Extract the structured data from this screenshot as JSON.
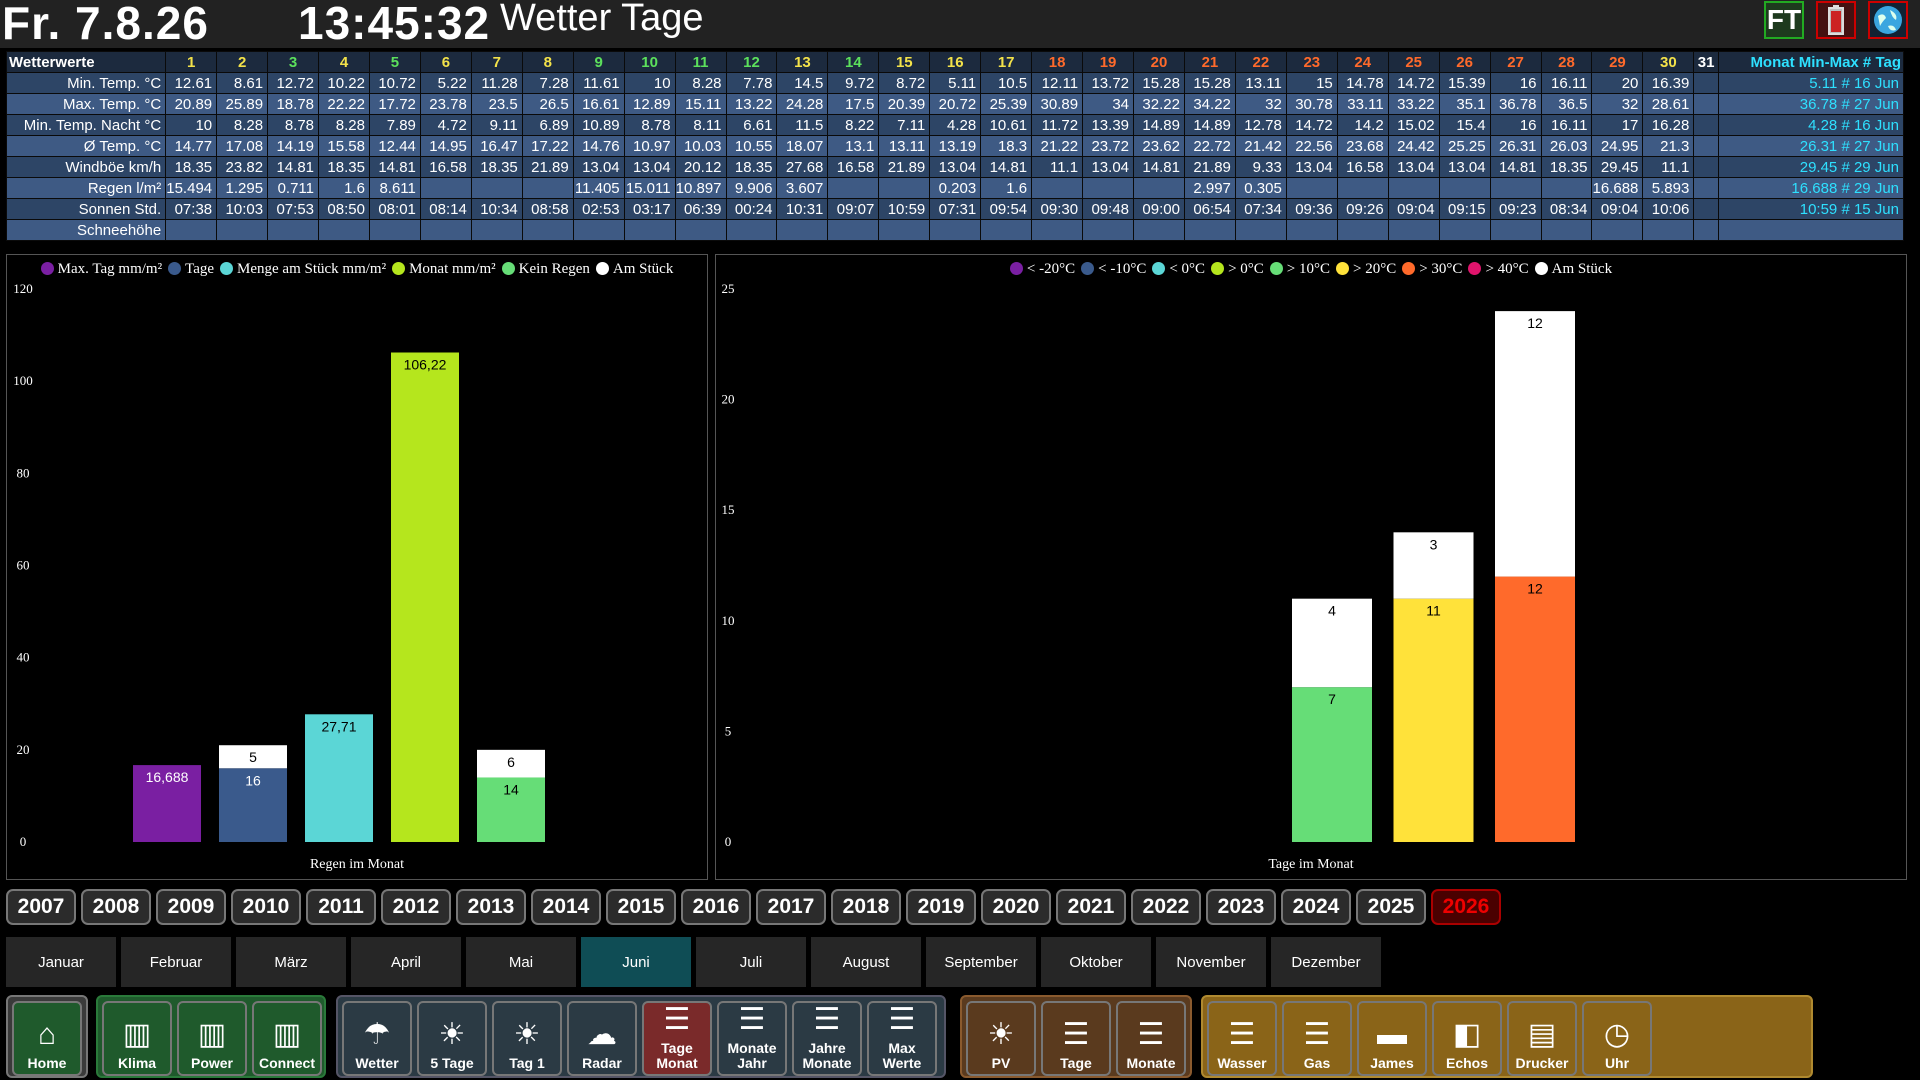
{
  "header": {
    "date": "Fr. 7.8.26",
    "time": "13:45:32",
    "title": "Wetter Tage",
    "ft_label": "FT"
  },
  "table": {
    "corner": "Wetterwerte",
    "days": [
      "1",
      "2",
      "3",
      "4",
      "5",
      "6",
      "7",
      "8",
      "9",
      "10",
      "11",
      "12",
      "13",
      "14",
      "15",
      "16",
      "17",
      "18",
      "19",
      "20",
      "21",
      "22",
      "23",
      "24",
      "25",
      "26",
      "27",
      "28",
      "29",
      "30",
      "31"
    ],
    "day_colors": [
      "#f3e24a",
      "#f3e24a",
      "#5ce05c",
      "#f3e24a",
      "#5ce05c",
      "#f3e24a",
      "#f3e24a",
      "#f3e24a",
      "#5ce05c",
      "#5ce05c",
      "#5ce05c",
      "#5ce05c",
      "#f3e24a",
      "#5ce05c",
      "#f3e24a",
      "#f3e24a",
      "#f3e24a",
      "#ff6a2b",
      "#ff6a2b",
      "#ff6a2b",
      "#ff6a2b",
      "#ff6a2b",
      "#ff6a2b",
      "#ff6a2b",
      "#ff6a2b",
      "#ff6a2b",
      "#ff6a2b",
      "#ff6a2b",
      "#ff6a2b",
      "#f3e24a",
      "#ffffff"
    ],
    "summary_header": "Monat Min-Max # Tag",
    "rows": [
      {
        "label": "Min. Temp. °C",
        "values": [
          "12.61",
          "8.61",
          "12.72",
          "10.22",
          "10.72",
          "5.22",
          "11.28",
          "7.28",
          "11.61",
          "10",
          "8.28",
          "7.78",
          "14.5",
          "9.72",
          "8.72",
          "5.11",
          "10.5",
          "12.11",
          "13.72",
          "15.28",
          "15.28",
          "13.11",
          "15",
          "14.78",
          "14.72",
          "15.39",
          "16",
          "16.11",
          "20",
          "16.39",
          ""
        ],
        "summary": "5.11 # 16 Jun"
      },
      {
        "label": "Max. Temp. °C",
        "values": [
          "20.89",
          "25.89",
          "18.78",
          "22.22",
          "17.72",
          "23.78",
          "23.5",
          "26.5",
          "16.61",
          "12.89",
          "15.11",
          "13.22",
          "24.28",
          "17.5",
          "20.39",
          "20.72",
          "25.39",
          "30.89",
          "34",
          "32.22",
          "34.22",
          "32",
          "30.78",
          "33.11",
          "33.22",
          "35.1",
          "36.78",
          "36.5",
          "32",
          "28.61",
          ""
        ],
        "summary": "36.78 # 27 Jun"
      },
      {
        "label": "Min. Temp. Nacht °C",
        "values": [
          "10",
          "8.28",
          "8.78",
          "8.28",
          "7.89",
          "4.72",
          "9.11",
          "6.89",
          "10.89",
          "8.78",
          "8.11",
          "6.61",
          "11.5",
          "8.22",
          "7.11",
          "4.28",
          "10.61",
          "11.72",
          "13.39",
          "14.89",
          "14.89",
          "12.78",
          "14.72",
          "14.2",
          "15.02",
          "15.4",
          "16",
          "16.11",
          "17",
          "16.28",
          ""
        ],
        "summary": "4.28 # 16 Jun"
      },
      {
        "label": "Ø Temp. °C",
        "values": [
          "14.77",
          "17.08",
          "14.19",
          "15.58",
          "12.44",
          "14.95",
          "16.47",
          "17.22",
          "14.76",
          "10.97",
          "10.03",
          "10.55",
          "18.07",
          "13.1",
          "13.11",
          "13.19",
          "18.3",
          "21.22",
          "23.72",
          "23.62",
          "22.72",
          "21.42",
          "22.56",
          "23.68",
          "24.42",
          "25.25",
          "26.31",
          "26.03",
          "24.95",
          "21.3",
          ""
        ],
        "summary": "26.31 # 27 Jun"
      },
      {
        "label": "Windböe km/h",
        "values": [
          "18.35",
          "23.82",
          "14.81",
          "18.35",
          "14.81",
          "16.58",
          "18.35",
          "21.89",
          "13.04",
          "13.04",
          "20.12",
          "18.35",
          "27.68",
          "16.58",
          "21.89",
          "13.04",
          "14.81",
          "11.1",
          "13.04",
          "14.81",
          "21.89",
          "9.33",
          "13.04",
          "16.58",
          "13.04",
          "13.04",
          "14.81",
          "18.35",
          "29.45",
          "11.1",
          ""
        ],
        "summary": "29.45 # 29 Jun"
      },
      {
        "label": "Regen l/m²",
        "values": [
          "15.494",
          "1.295",
          "0.711",
          "1.6",
          "8.611",
          "",
          "",
          "",
          "11.405",
          "15.011",
          "10.897",
          "9.906",
          "3.607",
          "",
          "",
          "0.203",
          "1.6",
          "",
          "",
          "",
          "2.997",
          "0.305",
          "",
          "",
          "",
          "",
          "",
          "",
          "16.688",
          "5.893",
          ""
        ],
        "summary": "16.688 # 29 Jun"
      },
      {
        "label": "Sonnen Std.",
        "values": [
          "07:38",
          "10:03",
          "07:53",
          "08:50",
          "08:01",
          "08:14",
          "10:34",
          "08:58",
          "02:53",
          "03:17",
          "06:39",
          "00:24",
          "10:31",
          "09:07",
          "10:59",
          "07:31",
          "09:54",
          "09:30",
          "09:48",
          "09:00",
          "06:54",
          "07:34",
          "09:36",
          "09:26",
          "09:04",
          "09:15",
          "09:23",
          "08:34",
          "09:04",
          "10:06",
          ""
        ],
        "summary": "10:59 # 15 Jun"
      },
      {
        "label": "Schneehöhe",
        "values": [
          "",
          "",
          "",
          "",
          "",
          "",
          "",
          "",
          "",
          "",
          "",
          "",
          "",
          "",
          "",
          "",
          "",
          "",
          "",
          "",
          "",
          "",
          "",
          "",
          "",
          "",
          "",
          "",
          "",
          "",
          ""
        ],
        "summary": ""
      }
    ]
  },
  "rain_chart": {
    "legend": [
      {
        "label": "Max. Tag mm/m²",
        "color": "#7a1fa2"
      },
      {
        "label": "Tage",
        "color": "#3a5a8c"
      },
      {
        "label": "Menge am Stück mm/m²",
        "color": "#5bd6d6"
      },
      {
        "label": "Monat mm/m²",
        "color": "#b5e61d"
      },
      {
        "label": "Kein Regen",
        "color": "#66dd77"
      },
      {
        "label": "Am Stück",
        "color": "#ffffff"
      }
    ],
    "xlabel": "Regen im Monat"
  },
  "temp_chart": {
    "legend": [
      {
        "label": "< -20°C",
        "color": "#7a1fa2"
      },
      {
        "label": "< -10°C",
        "color": "#3a5a8c"
      },
      {
        "label": "< 0°C",
        "color": "#5bd6d6"
      },
      {
        "label": "> 0°C",
        "color": "#b5e61d"
      },
      {
        "label": "> 10°C",
        "color": "#66dd77"
      },
      {
        "label": "> 20°C",
        "color": "#ffe23a"
      },
      {
        "label": "> 30°C",
        "color": "#ff6a2b"
      },
      {
        "label": "> 40°C",
        "color": "#e0146c"
      },
      {
        "label": "Am Stück",
        "color": "#ffffff"
      }
    ],
    "xlabel": "Tage im Monat"
  },
  "chart_data": [
    {
      "type": "bar",
      "xlabel": "Regen im Monat",
      "ylim": [
        0,
        120
      ],
      "yticks": [
        "0",
        "20",
        "40",
        "60",
        "80",
        "100",
        "120"
      ],
      "bars": [
        {
          "name": "Max. Tag mm/m²",
          "value": 16.688,
          "label": "16,688",
          "color": "#7a1fa2"
        },
        {
          "name": "Tage",
          "value": 16,
          "label": "16",
          "color": "#3a5a8c",
          "stack": {
            "name": "Am Stück",
            "value": 5,
            "label": "5",
            "color": "#ffffff"
          }
        },
        {
          "name": "Menge am Stück mm/m²",
          "value": 27.71,
          "label": "27,71",
          "color": "#5bd6d6"
        },
        {
          "name": "Monat mm/m²",
          "value": 106.22,
          "label": "106,22",
          "color": "#b5e61d"
        },
        {
          "name": "Kein Regen",
          "value": 14,
          "label": "14",
          "color": "#66dd77",
          "stack": {
            "name": "Am Stück",
            "value": 6,
            "label": "6",
            "color": "#ffffff"
          }
        }
      ]
    },
    {
      "type": "bar",
      "xlabel": "Tage im Monat",
      "ylim": [
        0,
        25
      ],
      "yticks": [
        "0",
        "5",
        "10",
        "15",
        "20",
        "25"
      ],
      "bars": [
        {
          "name": "> 10°C",
          "value": 7,
          "label": "7",
          "color": "#66dd77",
          "stack": {
            "name": "Am Stück",
            "value": 4,
            "label": "4",
            "color": "#ffffff"
          }
        },
        {
          "name": "> 20°C",
          "value": 11,
          "label": "11",
          "color": "#ffe23a",
          "stack": {
            "name": "Am Stück",
            "value": 3,
            "label": "3",
            "color": "#ffffff"
          }
        },
        {
          "name": "> 30°C",
          "value": 12,
          "label": "12",
          "color": "#ff6a2b",
          "stack": {
            "name": "Am Stück",
            "value": 12,
            "label": "12",
            "color": "#ffffff"
          }
        }
      ]
    }
  ],
  "years": [
    "2007",
    "2008",
    "2009",
    "2010",
    "2011",
    "2012",
    "2013",
    "2014",
    "2015",
    "2016",
    "2017",
    "2018",
    "2019",
    "2020",
    "2021",
    "2022",
    "2023",
    "2024",
    "2025",
    "2026"
  ],
  "active_year": "2026",
  "months": [
    "Januar",
    "Februar",
    "März",
    "April",
    "Mai",
    "Juni",
    "Juli",
    "August",
    "September",
    "Oktober",
    "November",
    "Dezember"
  ],
  "active_month": "Juni",
  "nav_groups": [
    {
      "bg": "#3a3a3a",
      "border": "#777",
      "buttons": [
        {
          "label": "Home",
          "icon": "home-icon",
          "glyph": "⌂",
          "bg": "#1f5a2c"
        }
      ]
    },
    {
      "bg": "#1f5a2c",
      "border": "#2a7a3a",
      "buttons": [
        {
          "label": "Klima",
          "icon": "building-icon",
          "glyph": "▥",
          "bg": "#1f5a2c"
        },
        {
          "label": "Power",
          "icon": "building-icon",
          "glyph": "▥",
          "bg": "#1f5a2c"
        },
        {
          "label": "Connect",
          "icon": "building-icon",
          "glyph": "▥",
          "bg": "#1f5a2c"
        }
      ]
    },
    {
      "bg": "#2b3a44",
      "border": "#556",
      "buttons": [
        {
          "label": "Wetter",
          "icon": "weather-station-icon",
          "glyph": "☂",
          "bg": "#2b3a44"
        },
        {
          "label": "5 Tage",
          "icon": "sun-cloud-icon",
          "glyph": "☀",
          "bg": "#2b3a44"
        },
        {
          "label": "Tag 1",
          "icon": "sun-cloud-icon",
          "glyph": "☀",
          "bg": "#2b3a44"
        },
        {
          "label": "Radar",
          "icon": "rain-cloud-icon",
          "glyph": "☁",
          "bg": "#2b3a44"
        },
        {
          "label": "Tage Monat",
          "icon": "document-icon",
          "glyph": "☰",
          "bg": "#7a2a2a"
        },
        {
          "label": "Monate Jahr",
          "icon": "document-icon",
          "glyph": "☰",
          "bg": "#2b3a44"
        },
        {
          "label": "Jahre Monate",
          "icon": "document-icon",
          "glyph": "☰",
          "bg": "#2b3a44"
        },
        {
          "label": "Max Werte",
          "icon": "document-icon",
          "glyph": "☰",
          "bg": "#2b3a44"
        }
      ]
    },
    {
      "bg": "#5a3a1e",
      "border": "#8a5a2e",
      "buttons": [
        {
          "label": "PV",
          "icon": "solar-panel-icon",
          "glyph": "☀",
          "bg": "#5a3a1e"
        },
        {
          "label": "Tage",
          "icon": "document-icon",
          "glyph": "☰",
          "bg": "#5a3a1e"
        },
        {
          "label": "Monate",
          "icon": "document-icon",
          "glyph": "☰",
          "bg": "#5a3a1e"
        }
      ]
    },
    {
      "bg": "#8a6418",
      "border": "#b08a30",
      "buttons": [
        {
          "label": "Wasser",
          "icon": "document-icon",
          "glyph": "☰",
          "bg": "#8a6418"
        },
        {
          "label": "Gas",
          "icon": "document-icon",
          "glyph": "☰",
          "bg": "#8a6418"
        },
        {
          "label": "James",
          "icon": "car-icon",
          "glyph": "▬",
          "bg": "#8a6418"
        },
        {
          "label": "Echos",
          "icon": "speaker-icon",
          "glyph": "◧",
          "bg": "#8a6418"
        },
        {
          "label": "Drucker",
          "icon": "printer-icon",
          "glyph": "▤",
          "bg": "#8a6418"
        },
        {
          "label": "Uhr",
          "icon": "clock-icon",
          "glyph": "◷",
          "bg": "#8a6418"
        }
      ]
    }
  ]
}
